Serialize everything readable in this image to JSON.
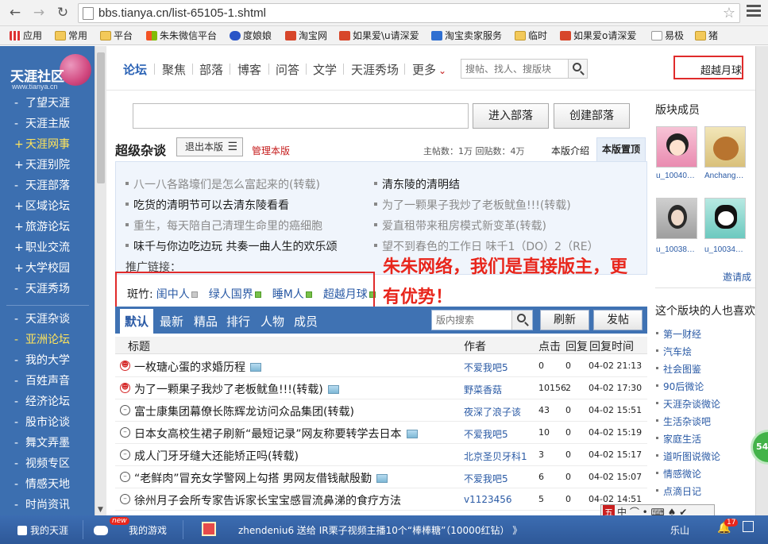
{
  "browser": {
    "url": "bbs.tianya.cn/list-65105-1.shtml",
    "bookmarks": [
      "应用",
      "常用",
      "平台",
      "朱朱微信平台",
      "度娘娘",
      "淘宝网",
      "如果爱\\u请深爱",
      "淘宝卖家服务",
      "临时",
      "如果爱o请深爱",
      "易极",
      "猪"
    ]
  },
  "sidebar": {
    "logo_text": "天涯社区",
    "logo_sub": "www.tianya.cn",
    "group1": [
      {
        "mark": "-",
        "label": "了望天涯"
      },
      {
        "mark": "-",
        "label": "天涯主版"
      },
      {
        "mark": "+",
        "label": "天涯网事"
      },
      {
        "mark": "+",
        "label": "天涯别院"
      },
      {
        "mark": "-",
        "label": "天涯部落"
      },
      {
        "mark": "+",
        "label": "区域论坛"
      },
      {
        "mark": "+",
        "label": "旅游论坛"
      },
      {
        "mark": "+",
        "label": "职业交流"
      },
      {
        "mark": "+",
        "label": "大学校园"
      },
      {
        "mark": "-",
        "label": "天涯秀场"
      }
    ],
    "group2": [
      {
        "mark": "-",
        "label": "天涯杂谈"
      },
      {
        "mark": "-",
        "label": "亚洲论坛"
      },
      {
        "mark": "-",
        "label": "我的大学"
      },
      {
        "mark": "-",
        "label": "百姓声音"
      },
      {
        "mark": "-",
        "label": "经济论坛"
      },
      {
        "mark": "-",
        "label": "股市论谈"
      },
      {
        "mark": "-",
        "label": "舞文弄墨"
      },
      {
        "mark": "-",
        "label": "视频专区"
      },
      {
        "mark": "-",
        "label": "情感天地"
      },
      {
        "mark": "-",
        "label": "时尚资讯"
      }
    ]
  },
  "topnav": {
    "links": [
      "论坛",
      "聚焦",
      "部落",
      "博客",
      "问答",
      "文学",
      "天涯秀场",
      "更多"
    ],
    "more_arrow": "⌄",
    "search_placeholder": "搜帖、找人、搜版块",
    "user": "超越月球"
  },
  "main": {
    "enter_button": "进入部落",
    "create_button": "创建部落",
    "forum_name": "超级杂谈",
    "exit_button": "退出本版",
    "manage": "管理本版",
    "stats": "主帖数：1万  回贴数：4万",
    "tab_intro": "本版介绍",
    "tab_top": "本版置顶",
    "sticky_left": [
      {
        "text": "八一八各路壕们是怎么富起来的(转载)",
        "style": "gray"
      },
      {
        "text": "吃货的清明节可以去清东陵看看",
        "style": "dark"
      },
      {
        "text": "重生，每天陪自己清理生命里的癌细胞",
        "style": "gray"
      },
      {
        "text": "味千与你边吃边玩 共奏一曲人生的欢乐颂",
        "style": "dark"
      }
    ],
    "sticky_right": [
      {
        "text": "清东陵的清明结",
        "style": "dark"
      },
      {
        "text": "为了一颗果子我炒了老板鱿鱼!!!(转载)",
        "style": "gray"
      },
      {
        "text": "爱直租带来租房模式新变革(转载)",
        "style": "gray"
      },
      {
        "text": "望不到春色的工作日 味千1（DO）2（RE）",
        "style": "gray"
      }
    ],
    "promo_label": "推广链接：",
    "moderators_label": "斑竹:",
    "moderators": [
      {
        "name": "闺中人",
        "status": "offline"
      },
      {
        "name": "绿人国界",
        "status": "online"
      },
      {
        "name": "睡M人",
        "status": "online"
      },
      {
        "name": "超越月球",
        "status": "online"
      }
    ],
    "ad_line1": "朱朱网络，我们是直接版主，更",
    "ad_line2": "有优势！",
    "list_tabs": [
      "默认",
      "最新",
      "精品",
      "排行",
      "人物",
      "成员"
    ],
    "list_search_placeholder": "版内搜索",
    "refresh": "刷新",
    "post": "发帖",
    "columns": [
      "标题",
      "作者",
      "点击",
      "回复",
      "回复时间"
    ],
    "rows": [
      {
        "face": "hot",
        "title": "一枚瑭心蛋的求婚历程",
        "pic": true,
        "author": "不爱我吧5",
        "clicks": "0",
        "replies": "0",
        "time": "04-02 21:13"
      },
      {
        "face": "hot",
        "title": "为了一颗果子我炒了老板鱿鱼!!!(转载)",
        "pic": true,
        "author": "野菜香菇",
        "clicks": "10156",
        "replies": "2",
        "time": "04-02 17:30"
      },
      {
        "face": "norm",
        "title": "富士康集团幕僚长陈辉龙访问众品集团(转载)",
        "pic": false,
        "author": "夜深了浪子该",
        "clicks": "43",
        "replies": "0",
        "time": "04-02 15:51"
      },
      {
        "face": "norm",
        "title": "日本女高校生裙子刷新“最短记录”网友称要转学去日本",
        "pic": true,
        "author": "不爱我吧5",
        "clicks": "10",
        "replies": "0",
        "time": "04-02 15:19"
      },
      {
        "face": "norm",
        "title": "成人门牙牙缝大还能矫正吗(转载)",
        "pic": false,
        "author": "北京圣贝牙科1",
        "clicks": "3",
        "replies": "0",
        "time": "04-02 15:17"
      },
      {
        "face": "norm",
        "title": "“老鲜肉”冒充女学警网上勾搭 男网友借钱献殷勤",
        "pic": true,
        "author": "不爱我吧5",
        "clicks": "6",
        "replies": "0",
        "time": "04-02 15:07"
      },
      {
        "face": "norm",
        "title": "徐州月子会所专家告诉家长宝宝感冒流鼻涕的食疗方法",
        "pic": false,
        "author": "v1123456",
        "clicks": "5",
        "replies": "0",
        "time": "04-02 14:51"
      }
    ]
  },
  "right": {
    "members_title": "版块成员",
    "members": [
      "u_10040…",
      "Anchang…",
      "u_10038…",
      "u_10034…"
    ],
    "invite": "邀请成",
    "likes_title": "这个版块的人也喜欢",
    "likes": [
      "第一财经",
      "汽车烩",
      "社会图鉴",
      "90后微论",
      "天涯杂谈微论",
      "生活杂谈吧",
      "家庭生活",
      "道听图说微论",
      "情感微论",
      "点滴日记"
    ],
    "green_badge": "54"
  },
  "ime": {
    "label": "五",
    "text": "中 ⌒ • ⌨ ♠ ✔"
  },
  "bottombar": {
    "my_tianya": "我的天涯",
    "new_badge": "new",
    "my_games": "我的游戏",
    "ticker": "zhendeniu6 送给 IR栗子视频主播10个“棒棒糖”（10000红钻） 》",
    "location": "乐山",
    "bell_count": "17"
  }
}
